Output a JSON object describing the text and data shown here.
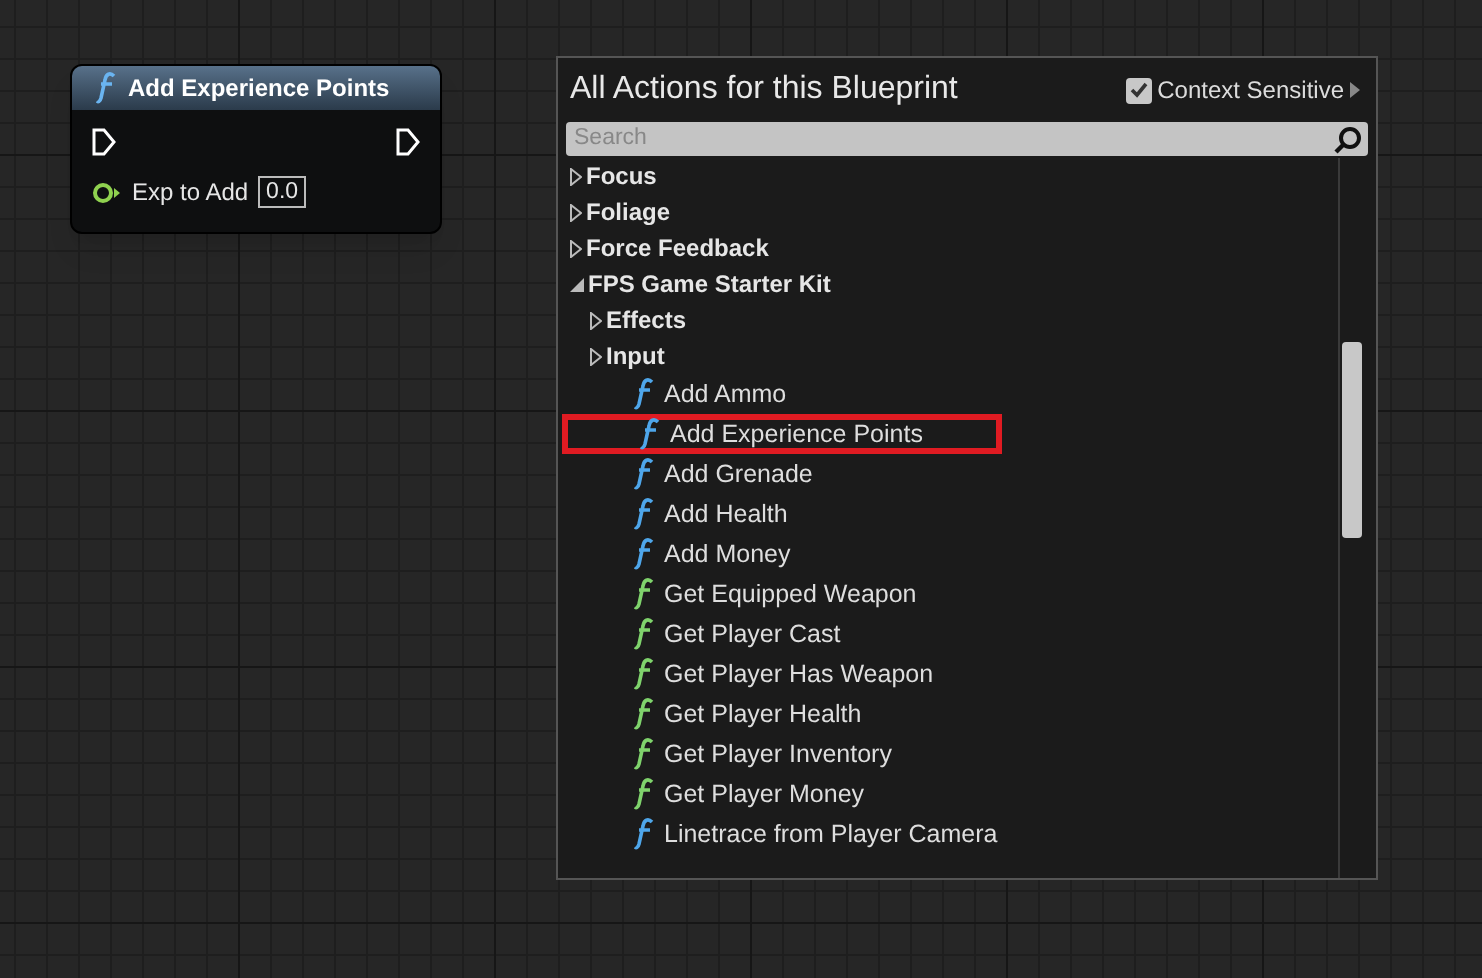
{
  "node": {
    "title": "Add Experience Points",
    "input": {
      "label": "Exp to Add",
      "value": "0.0"
    }
  },
  "panel": {
    "title": "All Actions for this Blueprint",
    "context_sensitive": {
      "label": "Context Sensitive",
      "checked": true
    },
    "search": {
      "placeholder": "Search"
    },
    "tree": [
      {
        "label": "Focus",
        "kind": "category",
        "expanded": false
      },
      {
        "label": "Foliage",
        "kind": "category",
        "expanded": false
      },
      {
        "label": "Force Feedback",
        "kind": "category",
        "expanded": false
      },
      {
        "label": "FPS Game Starter Kit",
        "kind": "category",
        "expanded": true,
        "children": [
          {
            "label": "Effects",
            "kind": "category",
            "expanded": false
          },
          {
            "label": "Input",
            "kind": "category",
            "expanded": false
          },
          {
            "label": "Add Ammo",
            "kind": "function",
            "color": "#4ea6ea",
            "highlighted": false
          },
          {
            "label": "Add Experience Points",
            "kind": "function",
            "color": "#4ea6ea",
            "highlighted": true
          },
          {
            "label": "Add Grenade",
            "kind": "function",
            "color": "#4ea6ea",
            "highlighted": false
          },
          {
            "label": "Add Health",
            "kind": "function",
            "color": "#4ea6ea",
            "highlighted": false
          },
          {
            "label": "Add Money",
            "kind": "function",
            "color": "#4ea6ea",
            "highlighted": false
          },
          {
            "label": "Get Equipped Weapon",
            "kind": "function",
            "color": "#7fd36c",
            "highlighted": false
          },
          {
            "label": "Get Player Cast",
            "kind": "function",
            "color": "#7fd36c",
            "highlighted": false
          },
          {
            "label": "Get Player Has Weapon",
            "kind": "function",
            "color": "#7fd36c",
            "highlighted": false
          },
          {
            "label": "Get Player Health",
            "kind": "function",
            "color": "#7fd36c",
            "highlighted": false
          },
          {
            "label": "Get Player Inventory",
            "kind": "function",
            "color": "#7fd36c",
            "highlighted": false
          },
          {
            "label": "Get Player Money",
            "kind": "function",
            "color": "#7fd36c",
            "highlighted": false
          },
          {
            "label": "Linetrace from Player Camera",
            "kind": "function",
            "color": "#4ea6ea",
            "highlighted": false
          }
        ]
      }
    ]
  }
}
